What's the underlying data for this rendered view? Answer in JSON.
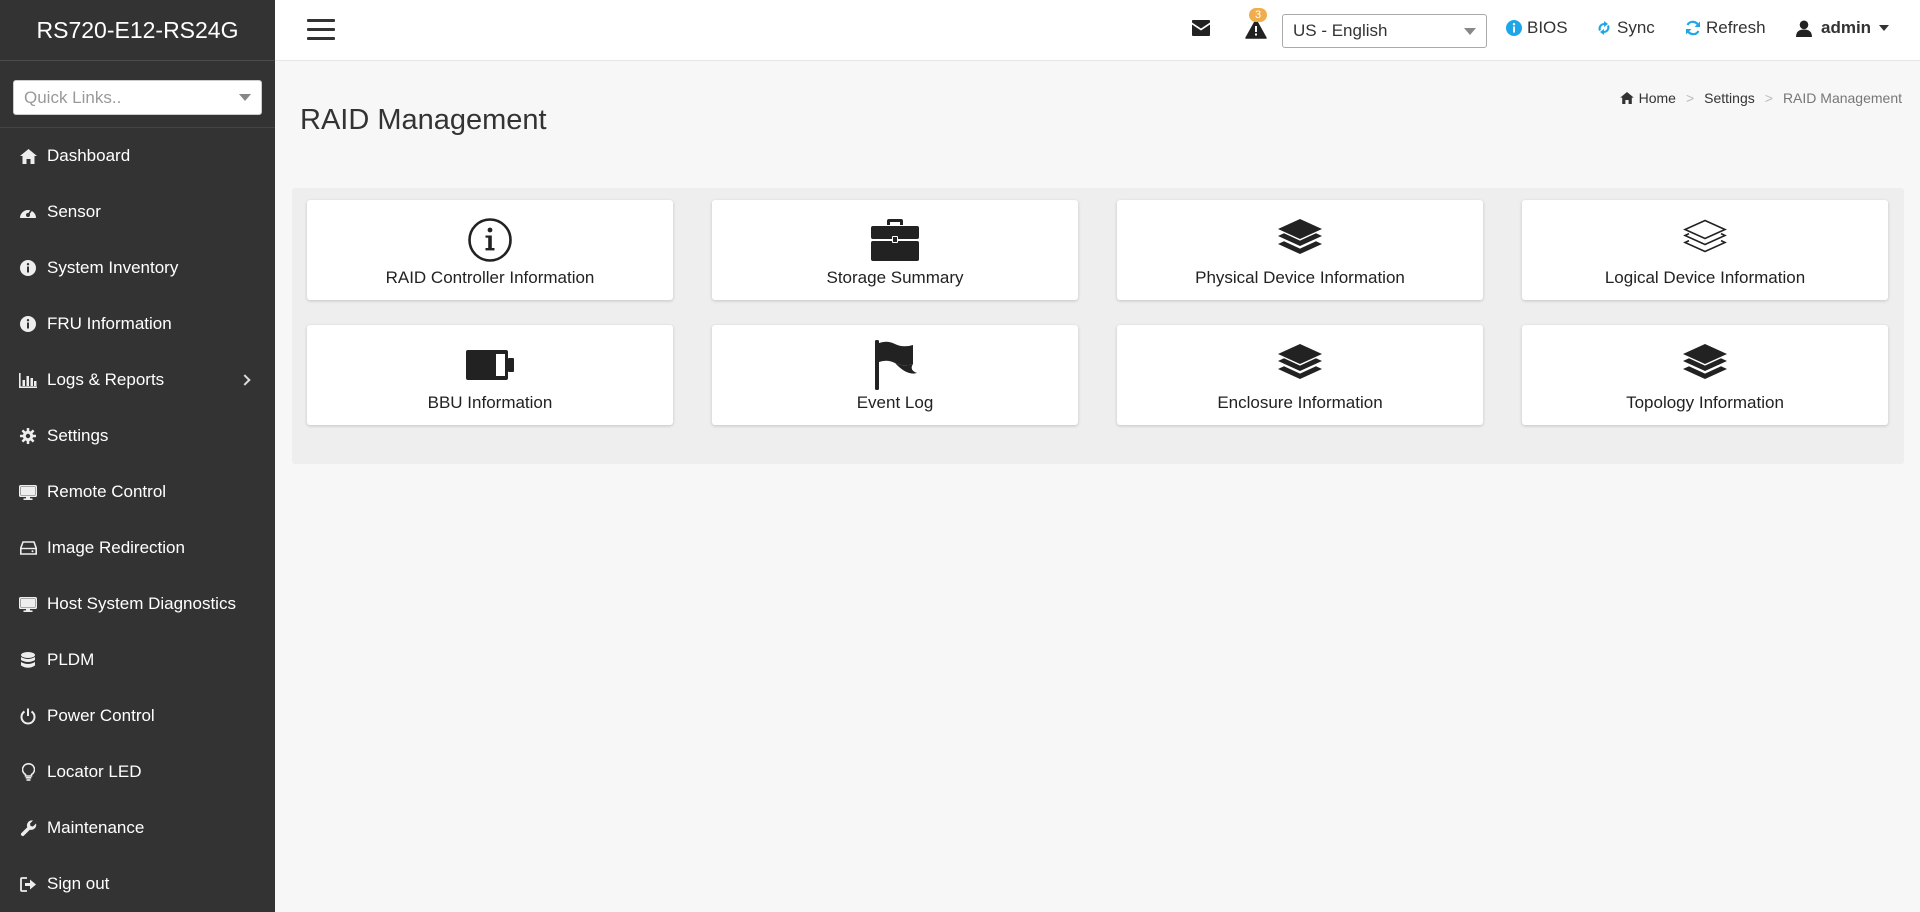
{
  "sidebar": {
    "brand": "RS720-E12-RS24G",
    "quick_links_placeholder": "Quick Links..",
    "items": [
      {
        "label": "Dashboard",
        "icon": "home-icon"
      },
      {
        "label": "Sensor",
        "icon": "dashboard-gauge-icon"
      },
      {
        "label": "System Inventory",
        "icon": "info-circle-icon"
      },
      {
        "label": "FRU Information",
        "icon": "info-circle-icon"
      },
      {
        "label": "Logs & Reports",
        "icon": "bar-chart-icon",
        "has_submenu": true
      },
      {
        "label": "Settings",
        "icon": "gear-icon"
      },
      {
        "label": "Remote Control",
        "icon": "monitor-icon"
      },
      {
        "label": "Image Redirection",
        "icon": "drive-icon"
      },
      {
        "label": "Host System Diagnostics",
        "icon": "monitor-icon"
      },
      {
        "label": "PLDM",
        "icon": "database-icon"
      },
      {
        "label": "Power Control",
        "icon": "power-icon"
      },
      {
        "label": "Locator LED",
        "icon": "lightbulb-icon"
      },
      {
        "label": "Maintenance",
        "icon": "wrench-icon"
      },
      {
        "label": "Sign out",
        "icon": "sign-out-icon"
      }
    ]
  },
  "header": {
    "alert_count": "3",
    "language": "US - English",
    "bios_label": "BIOS",
    "sync_label": "Sync",
    "refresh_label": "Refresh",
    "user_label": "admin",
    "icon_accent_color": "#1ea7e8"
  },
  "breadcrumb": {
    "home": "Home",
    "settings": "Settings",
    "current": "RAID Management"
  },
  "page_title": "RAID Management",
  "tiles": [
    {
      "label": "RAID Controller Information",
      "icon": "info-circle-outline-icon"
    },
    {
      "label": "Storage Summary",
      "icon": "briefcase-icon"
    },
    {
      "label": "Physical Device Information",
      "icon": "layers-icon"
    },
    {
      "label": "Logical Device Information",
      "icon": "layers-outline-icon"
    },
    {
      "label": "BBU Information",
      "icon": "battery-icon"
    },
    {
      "label": "Event Log",
      "icon": "flag-icon"
    },
    {
      "label": "Enclosure Information",
      "icon": "layers-icon"
    },
    {
      "label": "Topology Information",
      "icon": "layers-icon"
    }
  ]
}
